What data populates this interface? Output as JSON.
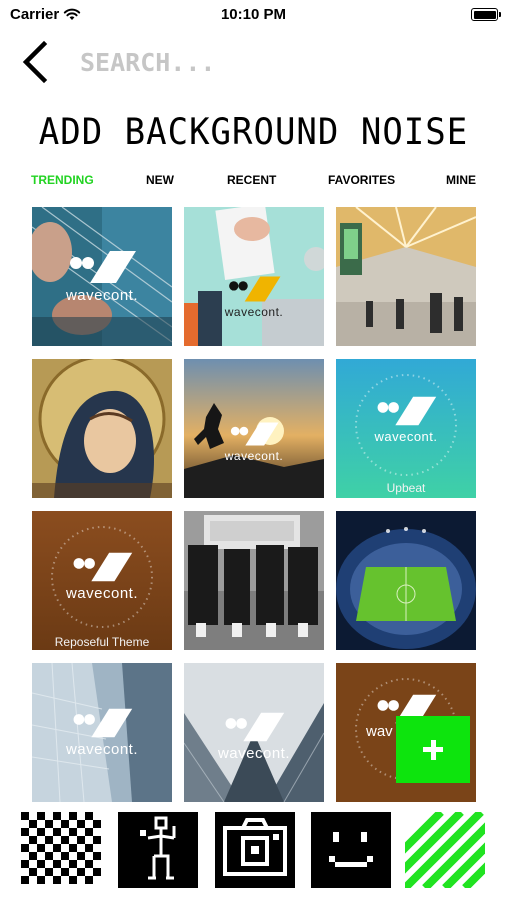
{
  "status": {
    "carrier": "Carrier",
    "time": "10:10 PM"
  },
  "icons": {
    "wifi": "wifi-icon",
    "battery": "battery-icon",
    "back": "chevron-left-icon",
    "plus": "plus-icon",
    "checker": "checkerboard-icon",
    "person": "pixel-person-icon",
    "camera": "pixel-camera-icon",
    "face": "pixel-smiley-icon",
    "stripes": "stripes-icon"
  },
  "search": {
    "placeholder": "SEARCH..."
  },
  "title": "ADD BACKGROUND NOISE",
  "tabs": [
    {
      "label": "TRENDING",
      "active": true
    },
    {
      "label": "NEW",
      "active": false
    },
    {
      "label": "RECENT",
      "active": false
    },
    {
      "label": "FAVORITES",
      "active": false
    },
    {
      "label": "MINE",
      "active": false
    }
  ],
  "tiles": [
    {
      "scene": "guitar strings",
      "logo": "wavecont."
    },
    {
      "scene": "desk with clipboard",
      "logo": "wavecont."
    },
    {
      "scene": "airport terminal",
      "logo": ""
    },
    {
      "scene": "religious painting",
      "logo": ""
    },
    {
      "scene": "silhouette at sunset",
      "logo": "wavecont."
    },
    {
      "scene": "teal gradient",
      "logo": "wavecont.",
      "caption": "Upbeat"
    },
    {
      "scene": "brown gradient",
      "logo": "wavecont.",
      "caption": "Reposeful Theme"
    },
    {
      "scene": "coffin dancers",
      "logo": ""
    },
    {
      "scene": "stadium aerial",
      "logo": ""
    },
    {
      "scene": "glass building",
      "logo": "wavecont."
    },
    {
      "scene": "skyscrapers looking up",
      "logo": "wavecont."
    },
    {
      "scene": "brown theme",
      "logo": "wav"
    }
  ],
  "colors": {
    "accent_green": "#22d322",
    "fab_green": "#0de40d",
    "placeholder_gray": "#c6c6c6",
    "stripe_green": "#21e321"
  }
}
